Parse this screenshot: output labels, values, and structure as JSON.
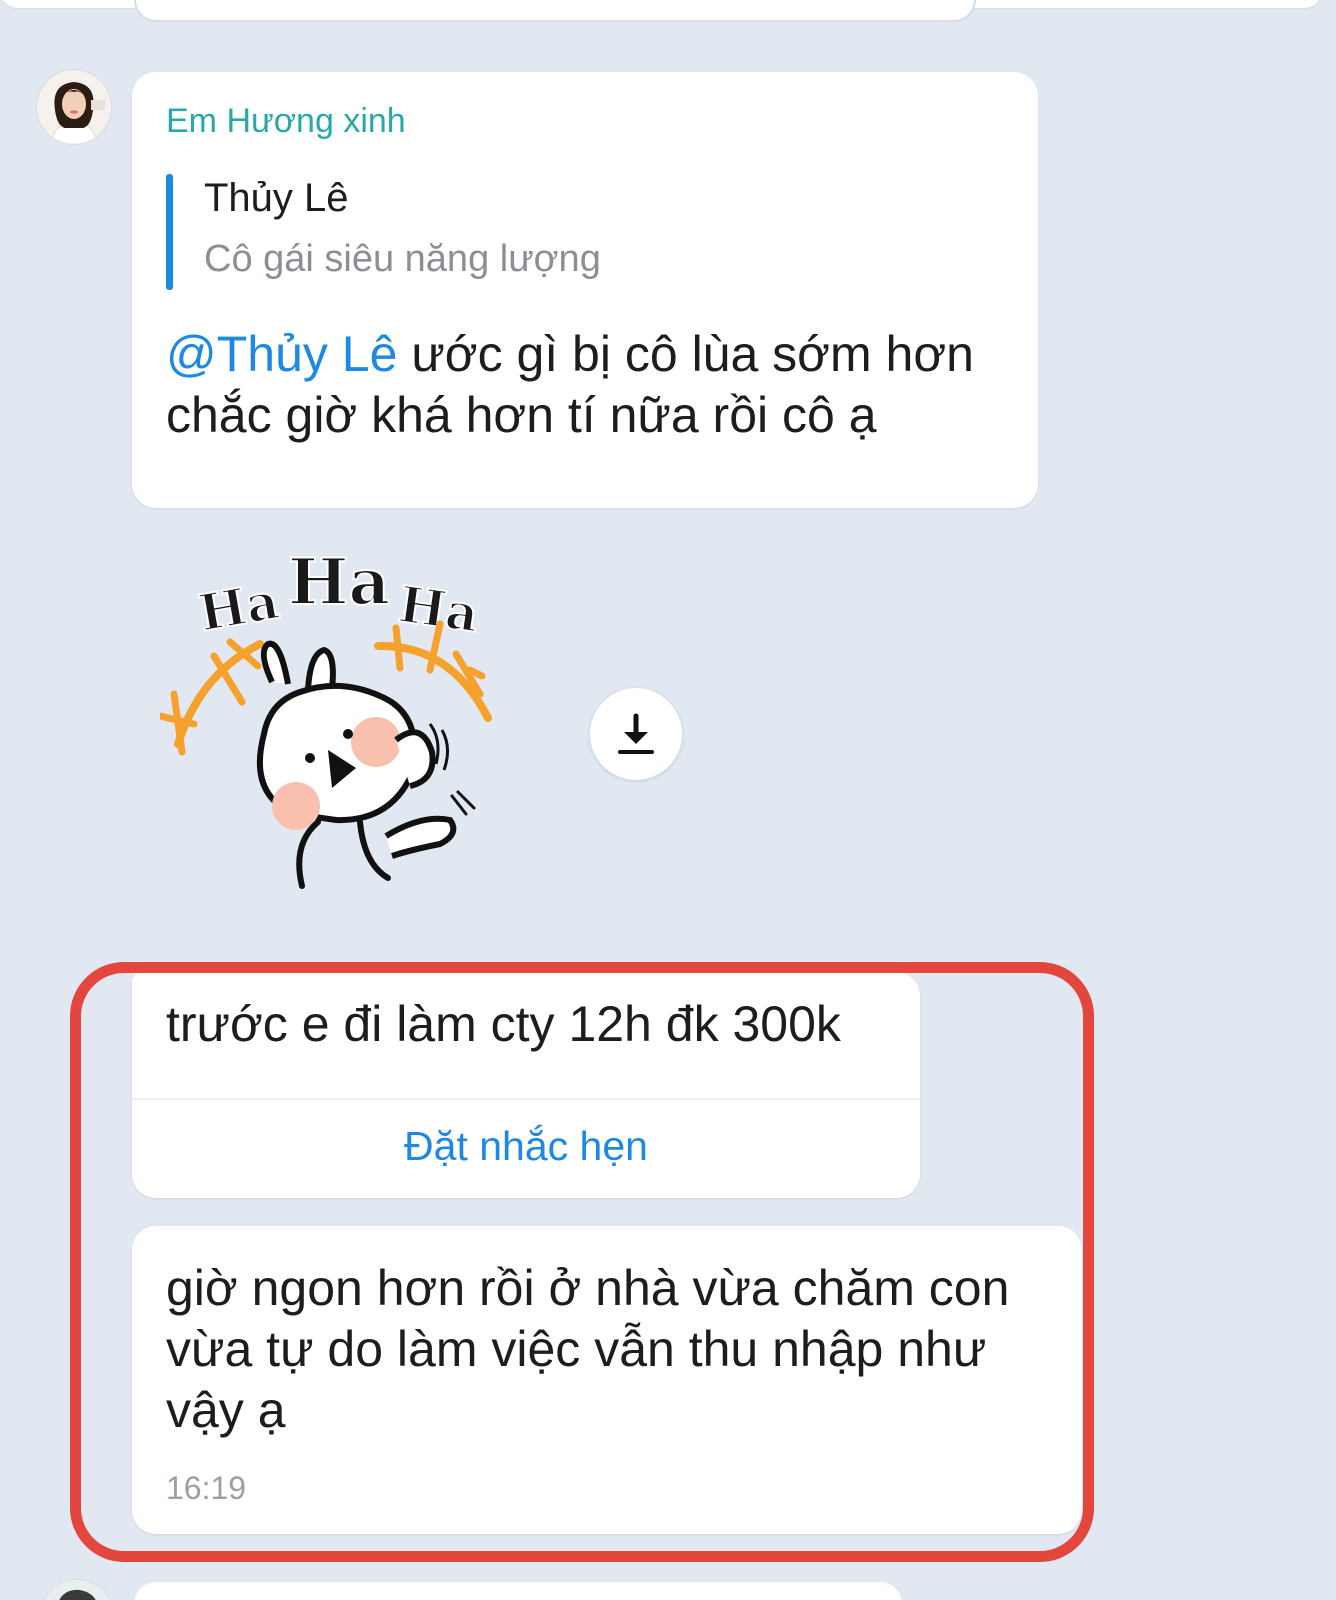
{
  "messages": {
    "first": {
      "sender": "Em Hương xinh",
      "quote": {
        "name": "Thủy Lê",
        "text": "Cô gái siêu năng lượng"
      },
      "mention": "@Thủy Lê",
      "line1_rest": " ước gì bị cô lùa sớm hơn",
      "line2": "chắc giờ khá hơn tí nữa rồi cô ạ"
    },
    "sticker": {
      "words": [
        "Ha",
        "Ha",
        "Ha"
      ]
    },
    "second": {
      "text": "trước e đi làm cty 12h đk 300k",
      "action": "Đặt nhắc hẹn"
    },
    "third": {
      "line1": "giờ ngon hơn rồi ở nhà vừa chăm con",
      "line2": "vừa tự do làm việc vẫn thu nhập như",
      "line3": "vậy ạ",
      "time": "16:19"
    }
  },
  "icons": {
    "download": "download-icon",
    "avatar": "avatar-image"
  },
  "colors": {
    "background": "#e1e8f2",
    "sender": "#2aa8a8",
    "link": "#1e88e5",
    "highlight": "#e2463c"
  }
}
